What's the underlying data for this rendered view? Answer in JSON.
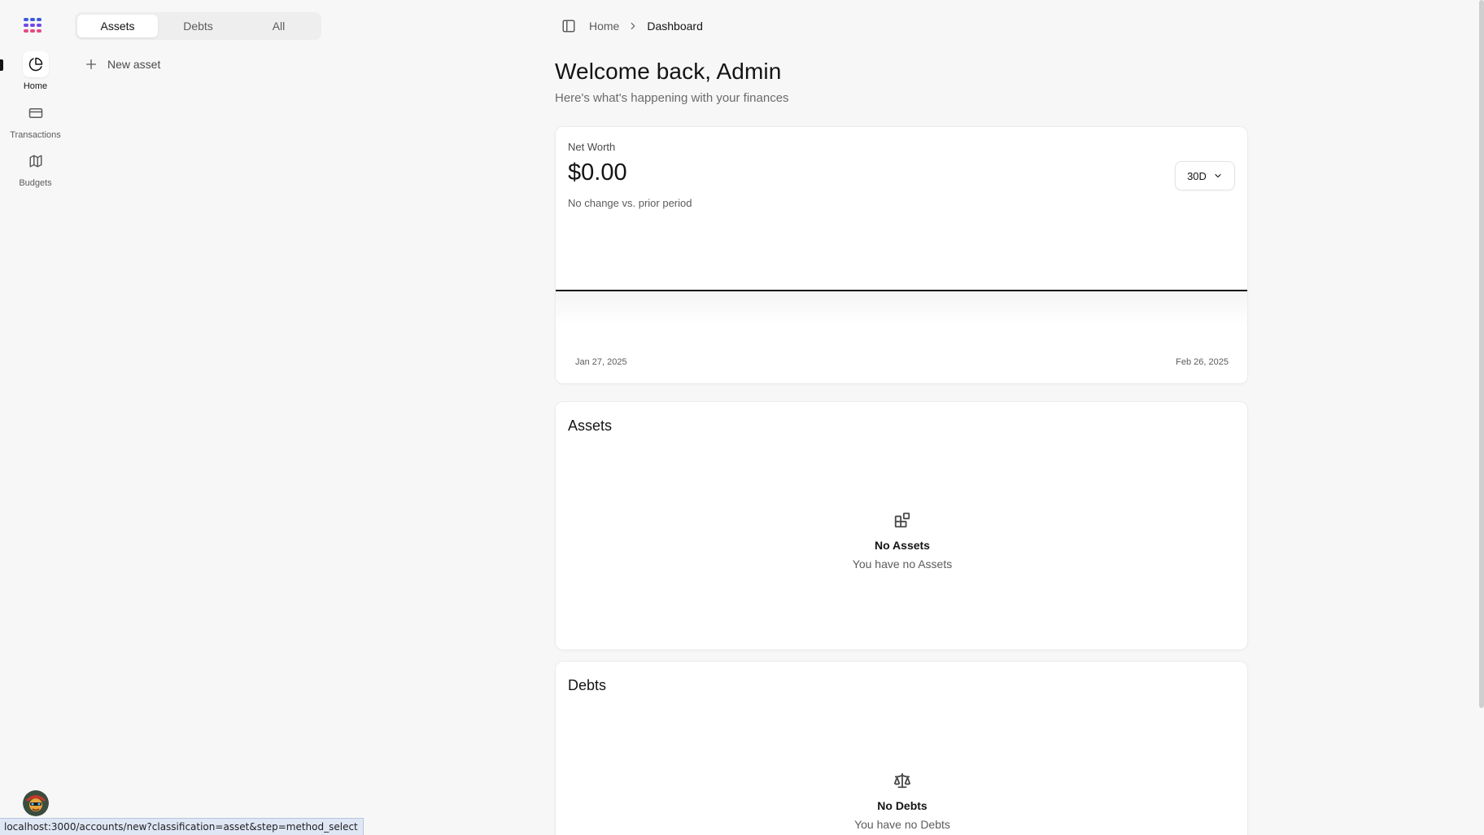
{
  "rail": {
    "items": [
      {
        "label": "Home",
        "icon": "pie-chart-icon",
        "active": true
      },
      {
        "label": "Transactions",
        "icon": "credit-card-icon",
        "active": false
      },
      {
        "label": "Budgets",
        "icon": "map-icon",
        "active": false
      }
    ]
  },
  "accounts_panel": {
    "tabs": [
      "Assets",
      "Debts",
      "All"
    ],
    "active_tab": "Assets",
    "new_asset_label": "New asset"
  },
  "breadcrumb": {
    "home": "Home",
    "current": "Dashboard"
  },
  "header": {
    "title": "Welcome back, Admin",
    "subtitle": "Here's what's happening with your finances"
  },
  "net_worth": {
    "label": "Net Worth",
    "value": "$0.00",
    "change_text": "No change vs. prior period",
    "period": "30D"
  },
  "chart_data": {
    "type": "line",
    "x": [
      "Jan 27, 2025",
      "Feb 26, 2025"
    ],
    "series": [
      {
        "values": [
          0,
          0
        ]
      }
    ],
    "x_tick_labels": [
      "Jan 27, 2025",
      "Feb 26, 2025"
    ],
    "grid": false
  },
  "assets": {
    "title": "Assets",
    "empty_title": "No Assets",
    "empty_text": "You have no Assets"
  },
  "debts": {
    "title": "Debts",
    "empty_title": "No Debts",
    "empty_text": "You have no Debts"
  },
  "status_url": "localhost:3000/accounts/new?classification=asset&step=method_select",
  "colors": {
    "background": "#f7f7f7",
    "card": "#ffffff",
    "text": "#141414",
    "muted": "#5c5c5c",
    "logo": [
      "#e91e8c",
      "#2563eb",
      "#7c3aed"
    ]
  }
}
